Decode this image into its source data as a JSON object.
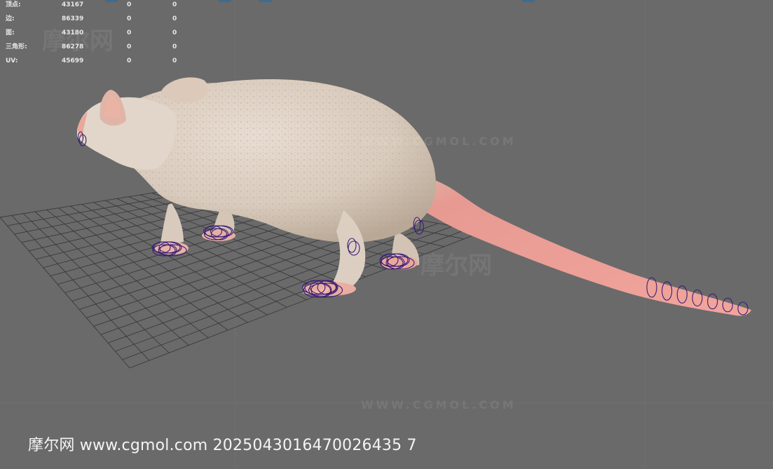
{
  "stats": {
    "rows": [
      {
        "label": "顶点:",
        "total": "43167",
        "selected": "0",
        "selected_alt": "0"
      },
      {
        "label": "边:",
        "total": "86339",
        "selected": "0",
        "selected_alt": "0"
      },
      {
        "label": "面:",
        "total": "43180",
        "selected": "0",
        "selected_alt": "0"
      },
      {
        "label": "三角形:",
        "total": "86278",
        "selected": "0",
        "selected_alt": "0"
      },
      {
        "label": "UV:",
        "total": "45699",
        "selected": "0",
        "selected_alt": "0"
      }
    ]
  },
  "caption": {
    "text": "摩尔网 www.cgmol.com 2025043016470026435 7"
  },
  "watermark": {
    "brand": "摩尔网",
    "url": "WWW.CGMOL.COM"
  },
  "colors": {
    "background": "#6a6a6a",
    "grid": "#3a3a3a",
    "fur": "#ddd0c4",
    "tail": "#e59a92",
    "rig": "#3a1f6e"
  }
}
